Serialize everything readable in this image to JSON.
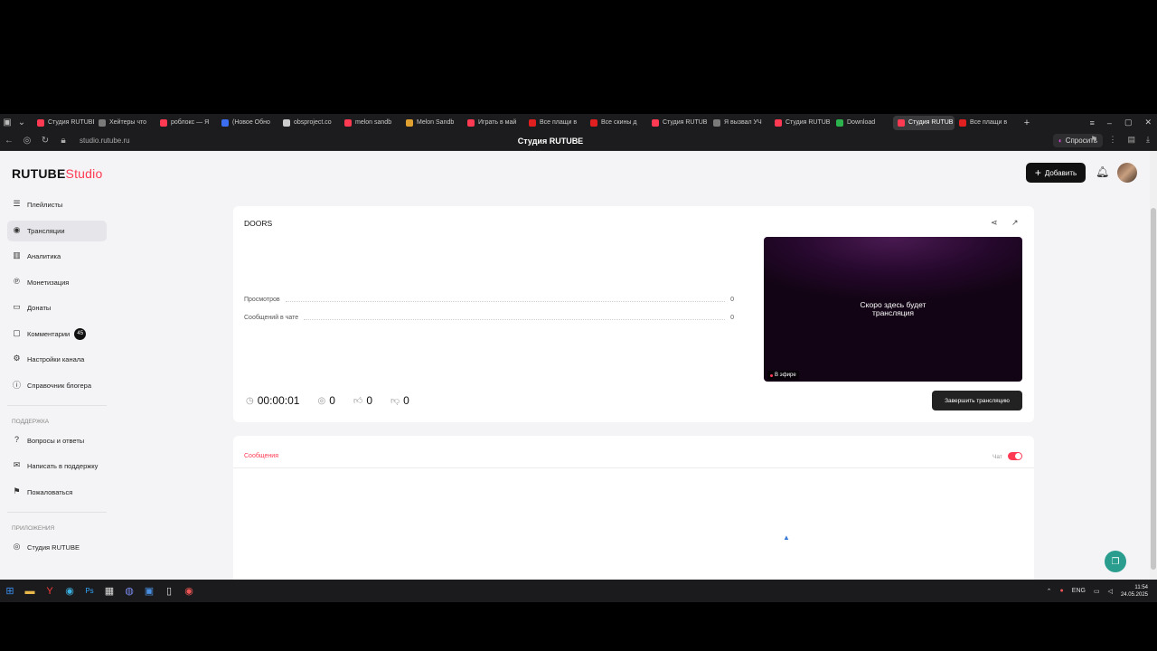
{
  "browser": {
    "tabs": [
      {
        "title": "Студия RUTUBE",
        "color": "#ff3a53"
      },
      {
        "title": "Хейтеры что",
        "color": "#7a7a7a"
      },
      {
        "title": "роблокс — Я",
        "color": "#ff3a53"
      },
      {
        "title": "(Новое Обно",
        "color": "#3a6df0"
      },
      {
        "title": "obsproject.co",
        "color": "#cccccc"
      },
      {
        "title": "melon sandb",
        "color": "#ff3a53"
      },
      {
        "title": "Melon Sandb",
        "color": "#e0a030"
      },
      {
        "title": "Играть в май",
        "color": "#ff3a53"
      },
      {
        "title": "Все плащи в",
        "color": "#e02020"
      },
      {
        "title": "Все скины д",
        "color": "#e02020"
      },
      {
        "title": "Студия RUTUB",
        "color": "#ff3a53"
      },
      {
        "title": "Я вызвал УЧ",
        "color": "#7a7a7a"
      },
      {
        "title": "Студия RUTUB",
        "color": "#ff3a53"
      },
      {
        "title": "Download",
        "color": "#2bb24c"
      },
      {
        "title": "Студия RUTUB",
        "color": "#ff3a53",
        "active": true
      },
      {
        "title": "Все плащи в",
        "color": "#e02020"
      }
    ],
    "url": "studio.rutube.ru",
    "page_title": "Студия RUTUBE",
    "ask_label": "Спросить"
  },
  "header": {
    "logo_main": "RUTUBE",
    "logo_studio": "Studio",
    "add_label": "Добавить"
  },
  "sidebar": {
    "items": [
      {
        "label": "Плейлисты",
        "icon": "☰"
      },
      {
        "label": "Трансляции",
        "icon": "◉",
        "active": true
      },
      {
        "label": "Аналитика",
        "icon": "▥"
      },
      {
        "label": "Монетизация",
        "icon": "℗"
      },
      {
        "label": "Донаты",
        "icon": "▭"
      },
      {
        "label": "Комментарии",
        "icon": "▢",
        "badge": "45"
      },
      {
        "label": "Настройки канала",
        "icon": "⚙"
      },
      {
        "label": "Справочник блогера",
        "icon": "ⓘ"
      }
    ],
    "support_heading": "Поддержка",
    "support_items": [
      {
        "label": "Вопросы и ответы",
        "icon": "?"
      },
      {
        "label": "Написать в поддержку",
        "icon": "✉"
      },
      {
        "label": "Пожаловаться",
        "icon": "⚑"
      }
    ],
    "apps_heading": "Приложения",
    "apps_items": [
      {
        "label": "Студия RUTUBE",
        "icon": "◎"
      }
    ]
  },
  "stream": {
    "name": "DOORS",
    "stats": [
      {
        "label": "Просмотров",
        "value": "0"
      },
      {
        "label": "Сообщений в чате",
        "value": "0"
      }
    ],
    "player_text_1": "Скоро здесь будет",
    "player_text_2": "трансляция",
    "live_label": "В эфире",
    "duration": "00:00:01",
    "viewers": "0",
    "likes": "0",
    "dislikes": "0",
    "end_label": "Завершить трансляцию"
  },
  "chat": {
    "tab_label": "Сообщения",
    "toggle_label": "Чат",
    "toggle_on": true
  },
  "taskbar": {
    "lang": "ENG",
    "time": "11:54",
    "date": "24.05.2025"
  }
}
